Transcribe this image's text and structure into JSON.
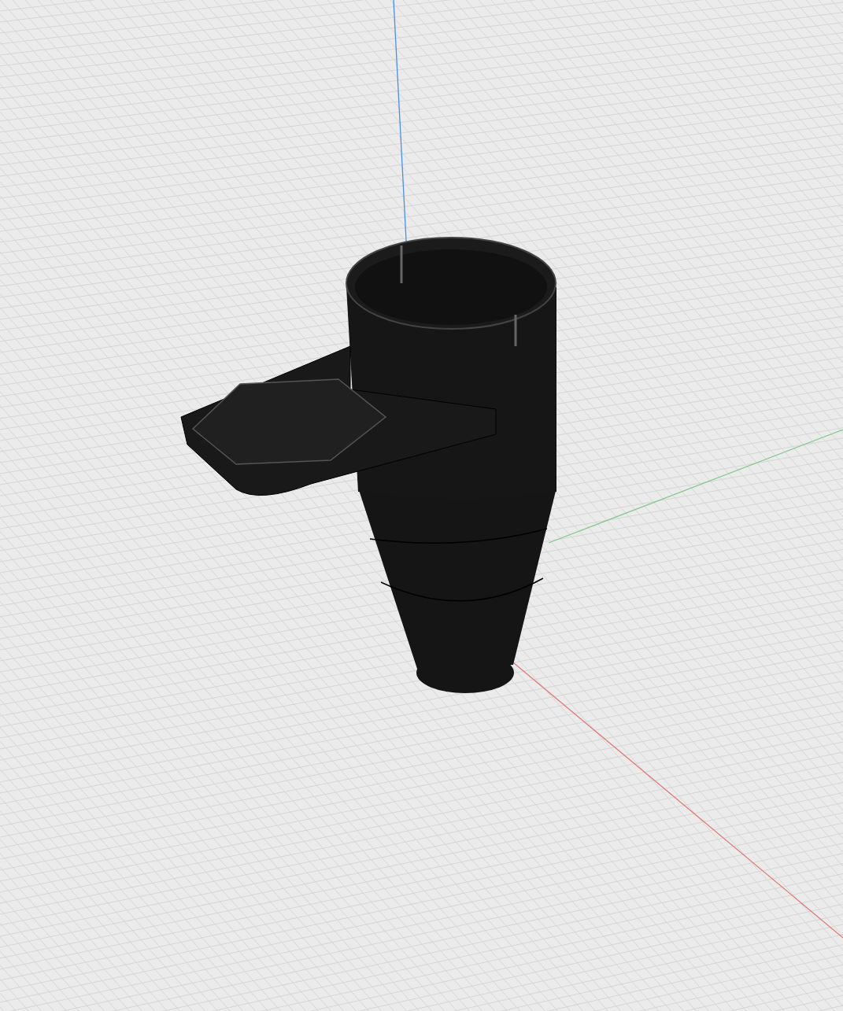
{
  "viewport": {
    "axes": [
      {
        "kind": "vertical",
        "color": "#4a90e2"
      },
      {
        "kind": "depth",
        "color": "#86c98e"
      },
      {
        "kind": "horizontal",
        "color": "#e07a7a"
      }
    ]
  }
}
